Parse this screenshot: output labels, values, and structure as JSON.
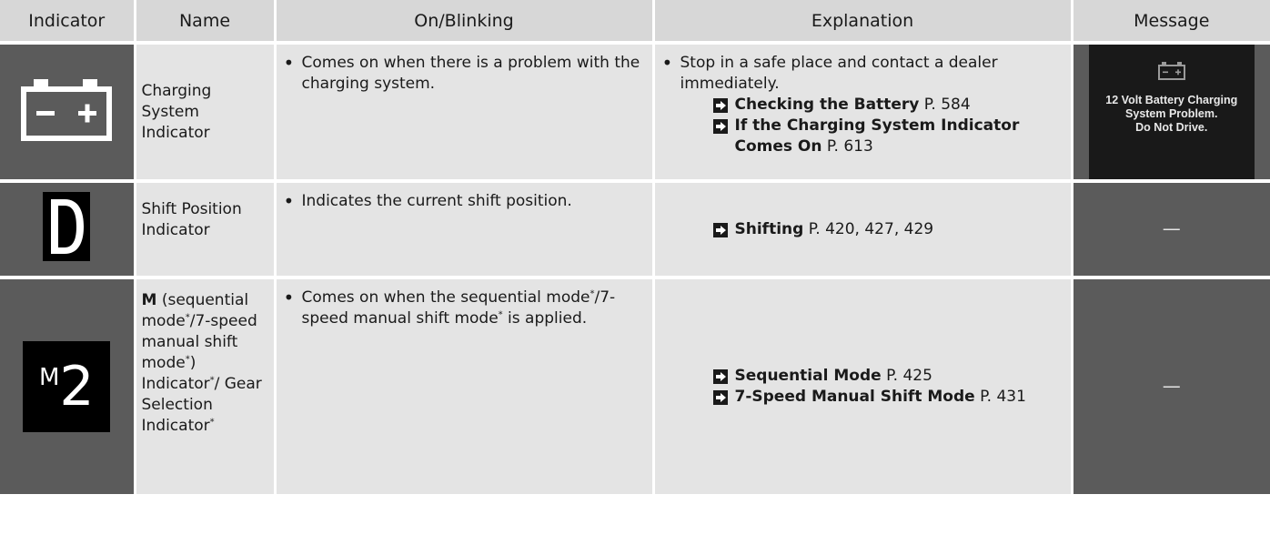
{
  "headers": [
    "Indicator",
    "Name",
    "On/Blinking",
    "Explanation",
    "Message"
  ],
  "rows": [
    {
      "icon": "battery-charging-icon",
      "name": "Charging System Indicator",
      "on": "Comes on when there is a problem with the charging system.",
      "explanation": "Stop in a safe place and contact a dealer immediately.",
      "refs": [
        {
          "title": "Checking the Battery",
          "page": "P. 584"
        },
        {
          "title": "If the Charging System Indicator Comes On",
          "page": "P. 613"
        }
      ],
      "message": {
        "icon": "battery-icon",
        "lines": [
          "12 Volt Battery Charging",
          "System Problem.",
          "Do Not Drive."
        ]
      }
    },
    {
      "icon": "shift-position-d-icon",
      "name": "Shift Position Indicator",
      "on": "Indicates the current shift position.",
      "refs": [
        {
          "title": "Shifting",
          "page": "P. 420, 427, 429"
        }
      ],
      "message": "—"
    },
    {
      "icon": "gear-selection-m2-icon",
      "icon_m": "M",
      "icon_gear": "2",
      "name": {
        "bold": "M",
        "p1": " (sequential mode",
        "star": "*",
        "p2": "/7-speed manual shift mode",
        "p3": ") Indicator",
        "p4": "/ Gear Selection Indicator"
      },
      "on": {
        "p1": "Comes on when the sequential mode",
        "star": "*",
        "p2": "/7-speed manual shift mode",
        "p3": " is applied."
      },
      "refs": [
        {
          "title": "Sequential Mode",
          "page": "P. 425"
        },
        {
          "title": "7-Speed Manual Shift Mode",
          "page": "P. 431"
        }
      ],
      "message": "—"
    }
  ]
}
